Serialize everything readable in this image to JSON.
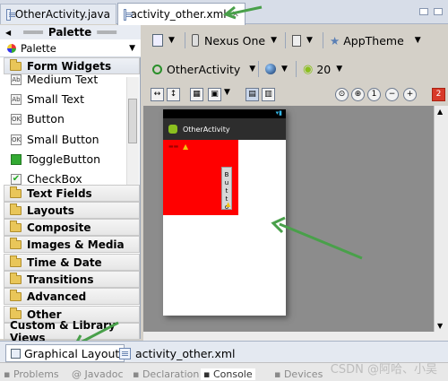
{
  "editor_tabs": {
    "tab1": "OtherActivity.java",
    "tab2": "activity_other.xml"
  },
  "palette": {
    "title": "Palette",
    "dropdown_label": "Palette",
    "open_category": "Form Widgets",
    "widgets": [
      "Medium Text",
      "Small Text",
      "Button",
      "Small Button",
      "ToggleButton",
      "CheckBox"
    ],
    "categories": [
      "Text Fields",
      "Layouts",
      "Composite",
      "Images & Media",
      "Time & Date",
      "Transitions",
      "Advanced",
      "Other",
      "Custom & Library Views"
    ]
  },
  "toolbar": {
    "device": "Nexus One",
    "theme": "AppTheme",
    "activity": "OtherActivity",
    "api_level": "20"
  },
  "preview": {
    "app_title": "OtherActivity",
    "button_text": "Button",
    "colors": {
      "red_layout": "#ff0000",
      "action_bar": "#2d2d2d"
    }
  },
  "bottom_tabs": {
    "graphical": "Graphical Layout",
    "xml": "activity_other.xml"
  },
  "views_bar": {
    "items": [
      "Problems",
      "Javadoc",
      "Declaration",
      "Console",
      "Devices"
    ]
  },
  "watermark": "CSDN @阿哈、小吴"
}
